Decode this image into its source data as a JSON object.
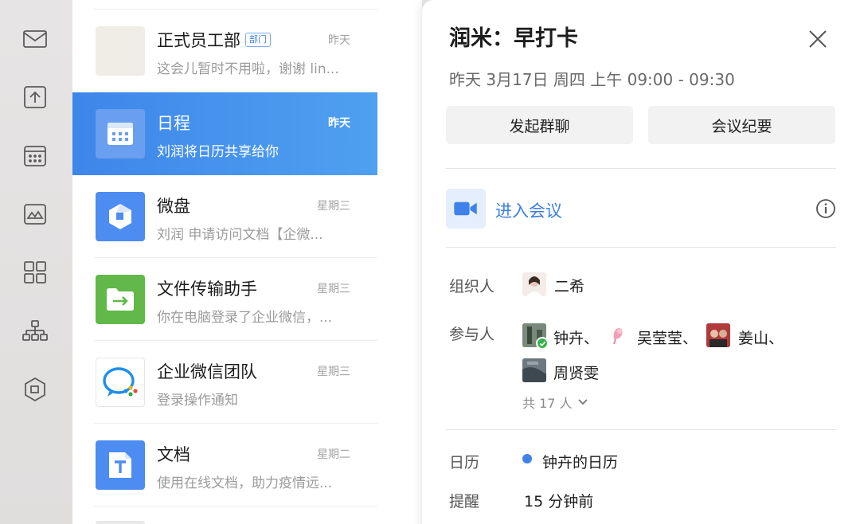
{
  "chat_list": [
    {
      "name": "正式员工部",
      "tag": "部门",
      "time": "昨天",
      "preview": "这会儿暂时不用啦，谢谢 lin...",
      "active": false
    },
    {
      "name": "日程",
      "tag": "",
      "time": "昨天",
      "preview": "刘润将日历共享给你",
      "active": true
    },
    {
      "name": "微盘",
      "tag": "",
      "time": "星期三",
      "preview": "刘润 申请访问文档【企微...",
      "active": false
    },
    {
      "name": "文件传输助手",
      "tag": "",
      "time": "星期三",
      "preview": "你在电脑登录了企业微信，...",
      "active": false
    },
    {
      "name": "企业微信团队",
      "tag": "",
      "time": "星期三",
      "preview": "登录操作通知",
      "active": false
    },
    {
      "name": "文档",
      "tag": "",
      "time": "星期二",
      "preview": "使用在线文档，助力疫情远...",
      "active": false
    }
  ],
  "detail": {
    "title": "润米：早打卡",
    "time": "昨天 3月17日 周四 上午 09:00 - 09:30",
    "btn_group_chat": "发起群聊",
    "btn_minutes": "会议纪要",
    "enter_meeting": "进入会议",
    "organizer_label": "组织人",
    "organizer_name": "二希",
    "participants_label": "参与人",
    "participants": [
      "钟卉",
      "吴莹莹",
      "姜山",
      "周贤雯"
    ],
    "sep": "、",
    "total": "共 17 人",
    "calendar_label": "日历",
    "calendar_value": "钟卉的日历",
    "reminder_label": "提醒",
    "reminder_value": "15 分钟前"
  },
  "colors": {
    "accent": "#3e86ea",
    "link": "#3d7fe3",
    "calendar_dot": "#3f82ea"
  }
}
